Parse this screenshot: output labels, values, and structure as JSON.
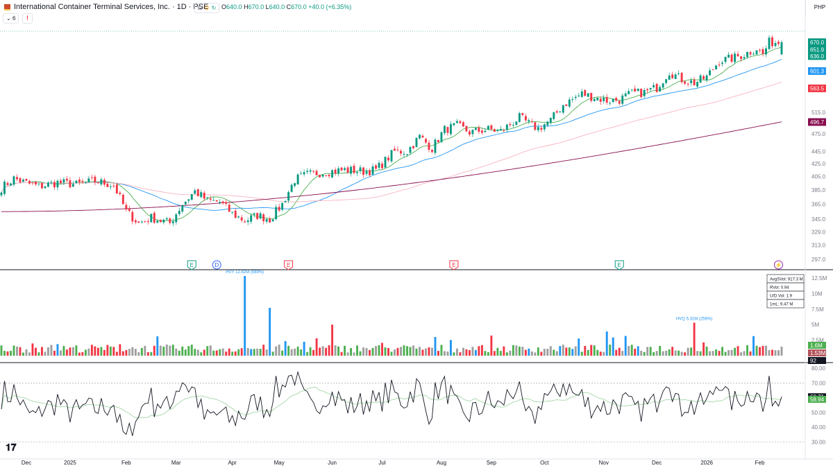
{
  "header": {
    "title": "International Container Terminal Services, Inc. · 1D · PSE",
    "buttons": [
      "⊟",
      "D",
      "↻"
    ],
    "ohlc": {
      "o_label": "O",
      "o": "640.0",
      "h_label": "H",
      "h": "670.0",
      "l_label": "L",
      "l": "640.0",
      "c_label": "C",
      "c": "670.0",
      "change": "+40.0 (+6.35%)"
    },
    "indicator_count": "6",
    "alert_label": "!",
    "currency": "PHP"
  },
  "colors": {
    "up": "#089981",
    "down": "#f23645",
    "ma_fast": "#4caf50",
    "ma_mid": "#2196f3",
    "ma_slow": "#f7b3bf",
    "ma_long": "#880e4f",
    "vol_up": "#4caf50",
    "vol_down": "#f23645",
    "vol_flat": "#9e9e9e",
    "vol_high_up": "#2196f3",
    "rsi": "#131722",
    "rsi_ma": "#a5d6a7"
  },
  "chart_data": [
    {
      "type": "candlestick",
      "title": "International Container Terminal Services, Inc.",
      "scale": "log",
      "ylim": [
        290,
        700
      ],
      "y_ticks": [
        297,
        313,
        329,
        345,
        365,
        385,
        405,
        425,
        445,
        475,
        515
      ],
      "y_tick_labels": [
        "297.0",
        "313.0",
        "329.0",
        "345.0",
        "365.0",
        "385.0",
        "405.0",
        "425.0",
        "445.0",
        "475.0",
        "515.0"
      ],
      "x_ticks": [
        {
          "label": "Dec",
          "i": 8
        },
        {
          "label": "2025",
          "i": 22
        },
        {
          "label": "Feb",
          "i": 40
        },
        {
          "label": "Mar",
          "i": 56
        },
        {
          "label": "Apr",
          "i": 74
        },
        {
          "label": "May",
          "i": 89
        },
        {
          "label": "Jun",
          "i": 106
        },
        {
          "label": "Jul",
          "i": 122
        },
        {
          "label": "Aug",
          "i": 141
        },
        {
          "label": "Sep",
          "i": 157
        },
        {
          "label": "Oct",
          "i": 174
        },
        {
          "label": "Nov",
          "i": 193
        },
        {
          "label": "Dec",
          "i": 210
        },
        {
          "label": "2026",
          "i": 226
        },
        {
          "label": "Feb",
          "i": 243
        }
      ],
      "price_anchors": [
        [
          0,
          388
        ],
        [
          4,
          402
        ],
        [
          8,
          395
        ],
        [
          12,
          390
        ],
        [
          18,
          396
        ],
        [
          24,
          393
        ],
        [
          30,
          398
        ],
        [
          36,
          392
        ],
        [
          40,
          355
        ],
        [
          44,
          340
        ],
        [
          48,
          347
        ],
        [
          54,
          340
        ],
        [
          58,
          365
        ],
        [
          62,
          383
        ],
        [
          66,
          370
        ],
        [
          70,
          368
        ],
        [
          74,
          352
        ],
        [
          78,
          343
        ],
        [
          82,
          350
        ],
        [
          86,
          345
        ],
        [
          90,
          365
        ],
        [
          94,
          400
        ],
        [
          98,
          408
        ],
        [
          104,
          412
        ],
        [
          110,
          415
        ],
        [
          116,
          413
        ],
        [
          120,
          415
        ],
        [
          126,
          445
        ],
        [
          130,
          445
        ],
        [
          134,
          470
        ],
        [
          138,
          450
        ],
        [
          142,
          483
        ],
        [
          146,
          490
        ],
        [
          150,
          478
        ],
        [
          156,
          483
        ],
        [
          160,
          480
        ],
        [
          166,
          505
        ],
        [
          170,
          490
        ],
        [
          172,
          485
        ],
        [
          176,
          500
        ],
        [
          180,
          530
        ],
        [
          186,
          552
        ],
        [
          190,
          545
        ],
        [
          194,
          538
        ],
        [
          198,
          540
        ],
        [
          202,
          553
        ],
        [
          206,
          555
        ],
        [
          210,
          565
        ],
        [
          214,
          600
        ],
        [
          218,
          583
        ],
        [
          222,
          575
        ],
        [
          226,
          588
        ],
        [
          230,
          625
        ],
        [
          234,
          630
        ],
        [
          238,
          640
        ],
        [
          242,
          655
        ],
        [
          244,
          640
        ],
        [
          246,
          670
        ]
      ],
      "last_close": 670.0,
      "price_labels": [
        {
          "text": "670.0",
          "value": 670.0,
          "color": "#089981"
        },
        {
          "text": "651.9",
          "value": 651.9,
          "color": "#089981"
        },
        {
          "text": "636.0",
          "value": 636.0,
          "color": "#089981"
        },
        {
          "text": "601.3",
          "value": 601.3,
          "color": "#2196f3"
        },
        {
          "text": "563.5",
          "value": 563.5,
          "color": "#f23645"
        },
        {
          "text": "496.7",
          "value": 496.7,
          "color": "#880e4f"
        }
      ],
      "event_markers": [
        {
          "letter": "E",
          "i": 61,
          "color": "#089981",
          "shape": "pent"
        },
        {
          "letter": "D",
          "i": 69,
          "color": "#2962ff",
          "shape": "circle"
        },
        {
          "letter": "E",
          "i": 92,
          "color": "#f23645",
          "shape": "pent"
        },
        {
          "letter": "E",
          "i": 145,
          "color": "#f23645",
          "shape": "pent"
        },
        {
          "letter": "E",
          "i": 198,
          "color": "#089981",
          "shape": "pent"
        },
        {
          "letter": "⚡",
          "i": 249,
          "color": "#9c27b0",
          "shape": "circle"
        }
      ]
    },
    {
      "type": "bar",
      "title": "Volume",
      "ylim": [
        0,
        13500000
      ],
      "y_ticks": [
        2500000,
        5000000,
        7500000,
        10000000,
        12500000
      ],
      "y_tick_labels": [
        "2.5M",
        "5M",
        "7.5M",
        "10M",
        "12.5M"
      ],
      "spikes": [
        {
          "i": 78,
          "value": 12820000,
          "color": "#2196f3",
          "label": "HVY 12.82M (589%)"
        },
        {
          "i": 86,
          "value": 7700000,
          "color": "#2196f3"
        },
        {
          "i": 106,
          "value": 5000000,
          "color": "#f23645"
        },
        {
          "i": 194,
          "value": 3900000,
          "color": "#2196f3"
        },
        {
          "i": 222,
          "value": 5310000,
          "color": "#f23645",
          "label": "HVQ 5.31M (256%)"
        }
      ],
      "stats_box": [
        "AvgSVol: 917.3 M",
        "RVol: 0.94",
        "U/D Vol: 1.9",
        "1mL: 9.47 M"
      ],
      "value_labels": [
        {
          "text": "1.6M",
          "value": 1600000,
          "color": "#4caf50"
        },
        {
          "text": "1.53M",
          "value": 1530000,
          "color": "#b2545a"
        },
        {
          "text": "92",
          "value": 0,
          "color": "#131722"
        }
      ]
    },
    {
      "type": "line",
      "title": "RSI",
      "ylim": [
        25,
        82
      ],
      "y_ticks": [
        30,
        40,
        50,
        60,
        70,
        80
      ],
      "y_tick_labels": [
        "30.00",
        "40.00",
        "50.00",
        "60.00",
        "70.00",
        "80.00"
      ],
      "bands": [
        30,
        70
      ],
      "last_values": [
        {
          "text": "60.71",
          "value": 60.71,
          "color": "#131722"
        },
        {
          "text": "58.94",
          "value": 58.94,
          "color": "#4caf50"
        }
      ]
    }
  ]
}
